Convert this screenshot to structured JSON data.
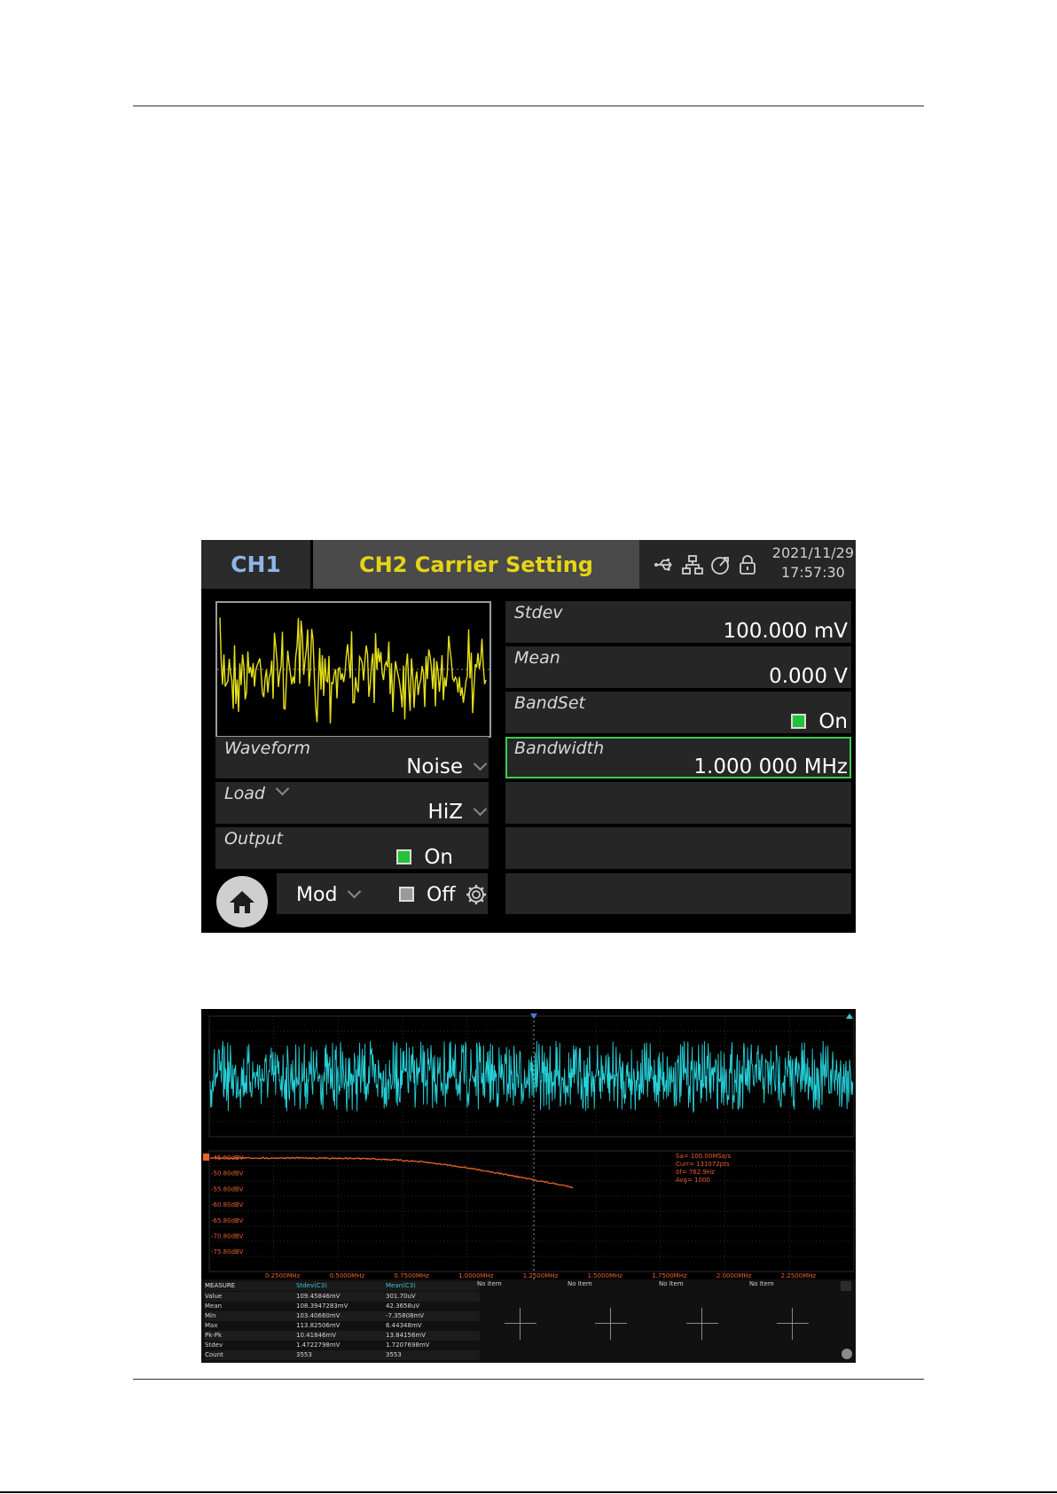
{
  "generator": {
    "tab_channel": "CH1",
    "title": "CH2 Carrier Setting",
    "status_icons": [
      "usb-icon",
      "network-icon",
      "clock-sync-icon",
      "lock-icon"
    ],
    "date": "2021/11/29",
    "time": "17:57:30",
    "waveform": {
      "label": "Waveform",
      "value": "Noise"
    },
    "load": {
      "label": "Load",
      "value": "HiZ"
    },
    "output": {
      "label": "Output",
      "value": "On",
      "checked": true
    },
    "mod": {
      "label": "Mod",
      "value": "Off",
      "checked": false
    },
    "params": [
      {
        "label": "Stdev",
        "value": "100.000 mV"
      },
      {
        "label": "Mean",
        "value": "0.000 V"
      },
      {
        "label": "BandSet",
        "value": "On",
        "checked": true
      },
      {
        "label": "Bandwidth",
        "value": "1.000 000 MHz",
        "selected": true
      }
    ],
    "colors": {
      "accent": "#e6d516",
      "selected": "#3dcc4a",
      "ch1": "#8fb4e8"
    }
  },
  "oscilloscope": {
    "fft_info": [
      "Sa= 100.00MSa/s",
      "Curr= 131072pts",
      "δf= 762.9Hz",
      "Avg= 1000"
    ],
    "fft_ylabels": [
      "-45.80dBV",
      "-50.80dBV",
      "-55.80dBV",
      "-60.80dBV",
      "-65.80dBV",
      "-70.80dBV",
      "-75.80dBV"
    ],
    "fft_xlabels": [
      "0.2500MHz",
      "0.5000MHz",
      "0.7500MHz",
      "1.0000MHz",
      "1.2500MHz",
      "1.5000MHz",
      "1.7500MHz",
      "2.0000MHz",
      "2.2500MHz"
    ],
    "measure": {
      "header": [
        "MEASURE",
        "Stdev(C3)",
        "Mean(C3)"
      ],
      "rows": [
        [
          "Value",
          "109.45846mV",
          "301.70uV"
        ],
        [
          "Mean",
          "108.3947283mV",
          "42.3658uV"
        ],
        [
          "Min",
          "103.40660mV",
          "-7.35808mV"
        ],
        [
          "Max",
          "113.82506mV",
          "6.44348mV"
        ],
        [
          "Pk-Pk",
          "10.41846mV",
          "13.84156mV"
        ],
        [
          "Stdev",
          "1.4722798mV",
          "1.7207698mV"
        ],
        [
          "Count",
          "3553",
          "3553"
        ]
      ],
      "empty_slots": [
        "No Item",
        "No Item",
        "No Item",
        "No Item"
      ]
    },
    "colors": {
      "trace": "#26d0d8",
      "fft": "#e8622a",
      "grid": "#3a3a3a"
    }
  }
}
